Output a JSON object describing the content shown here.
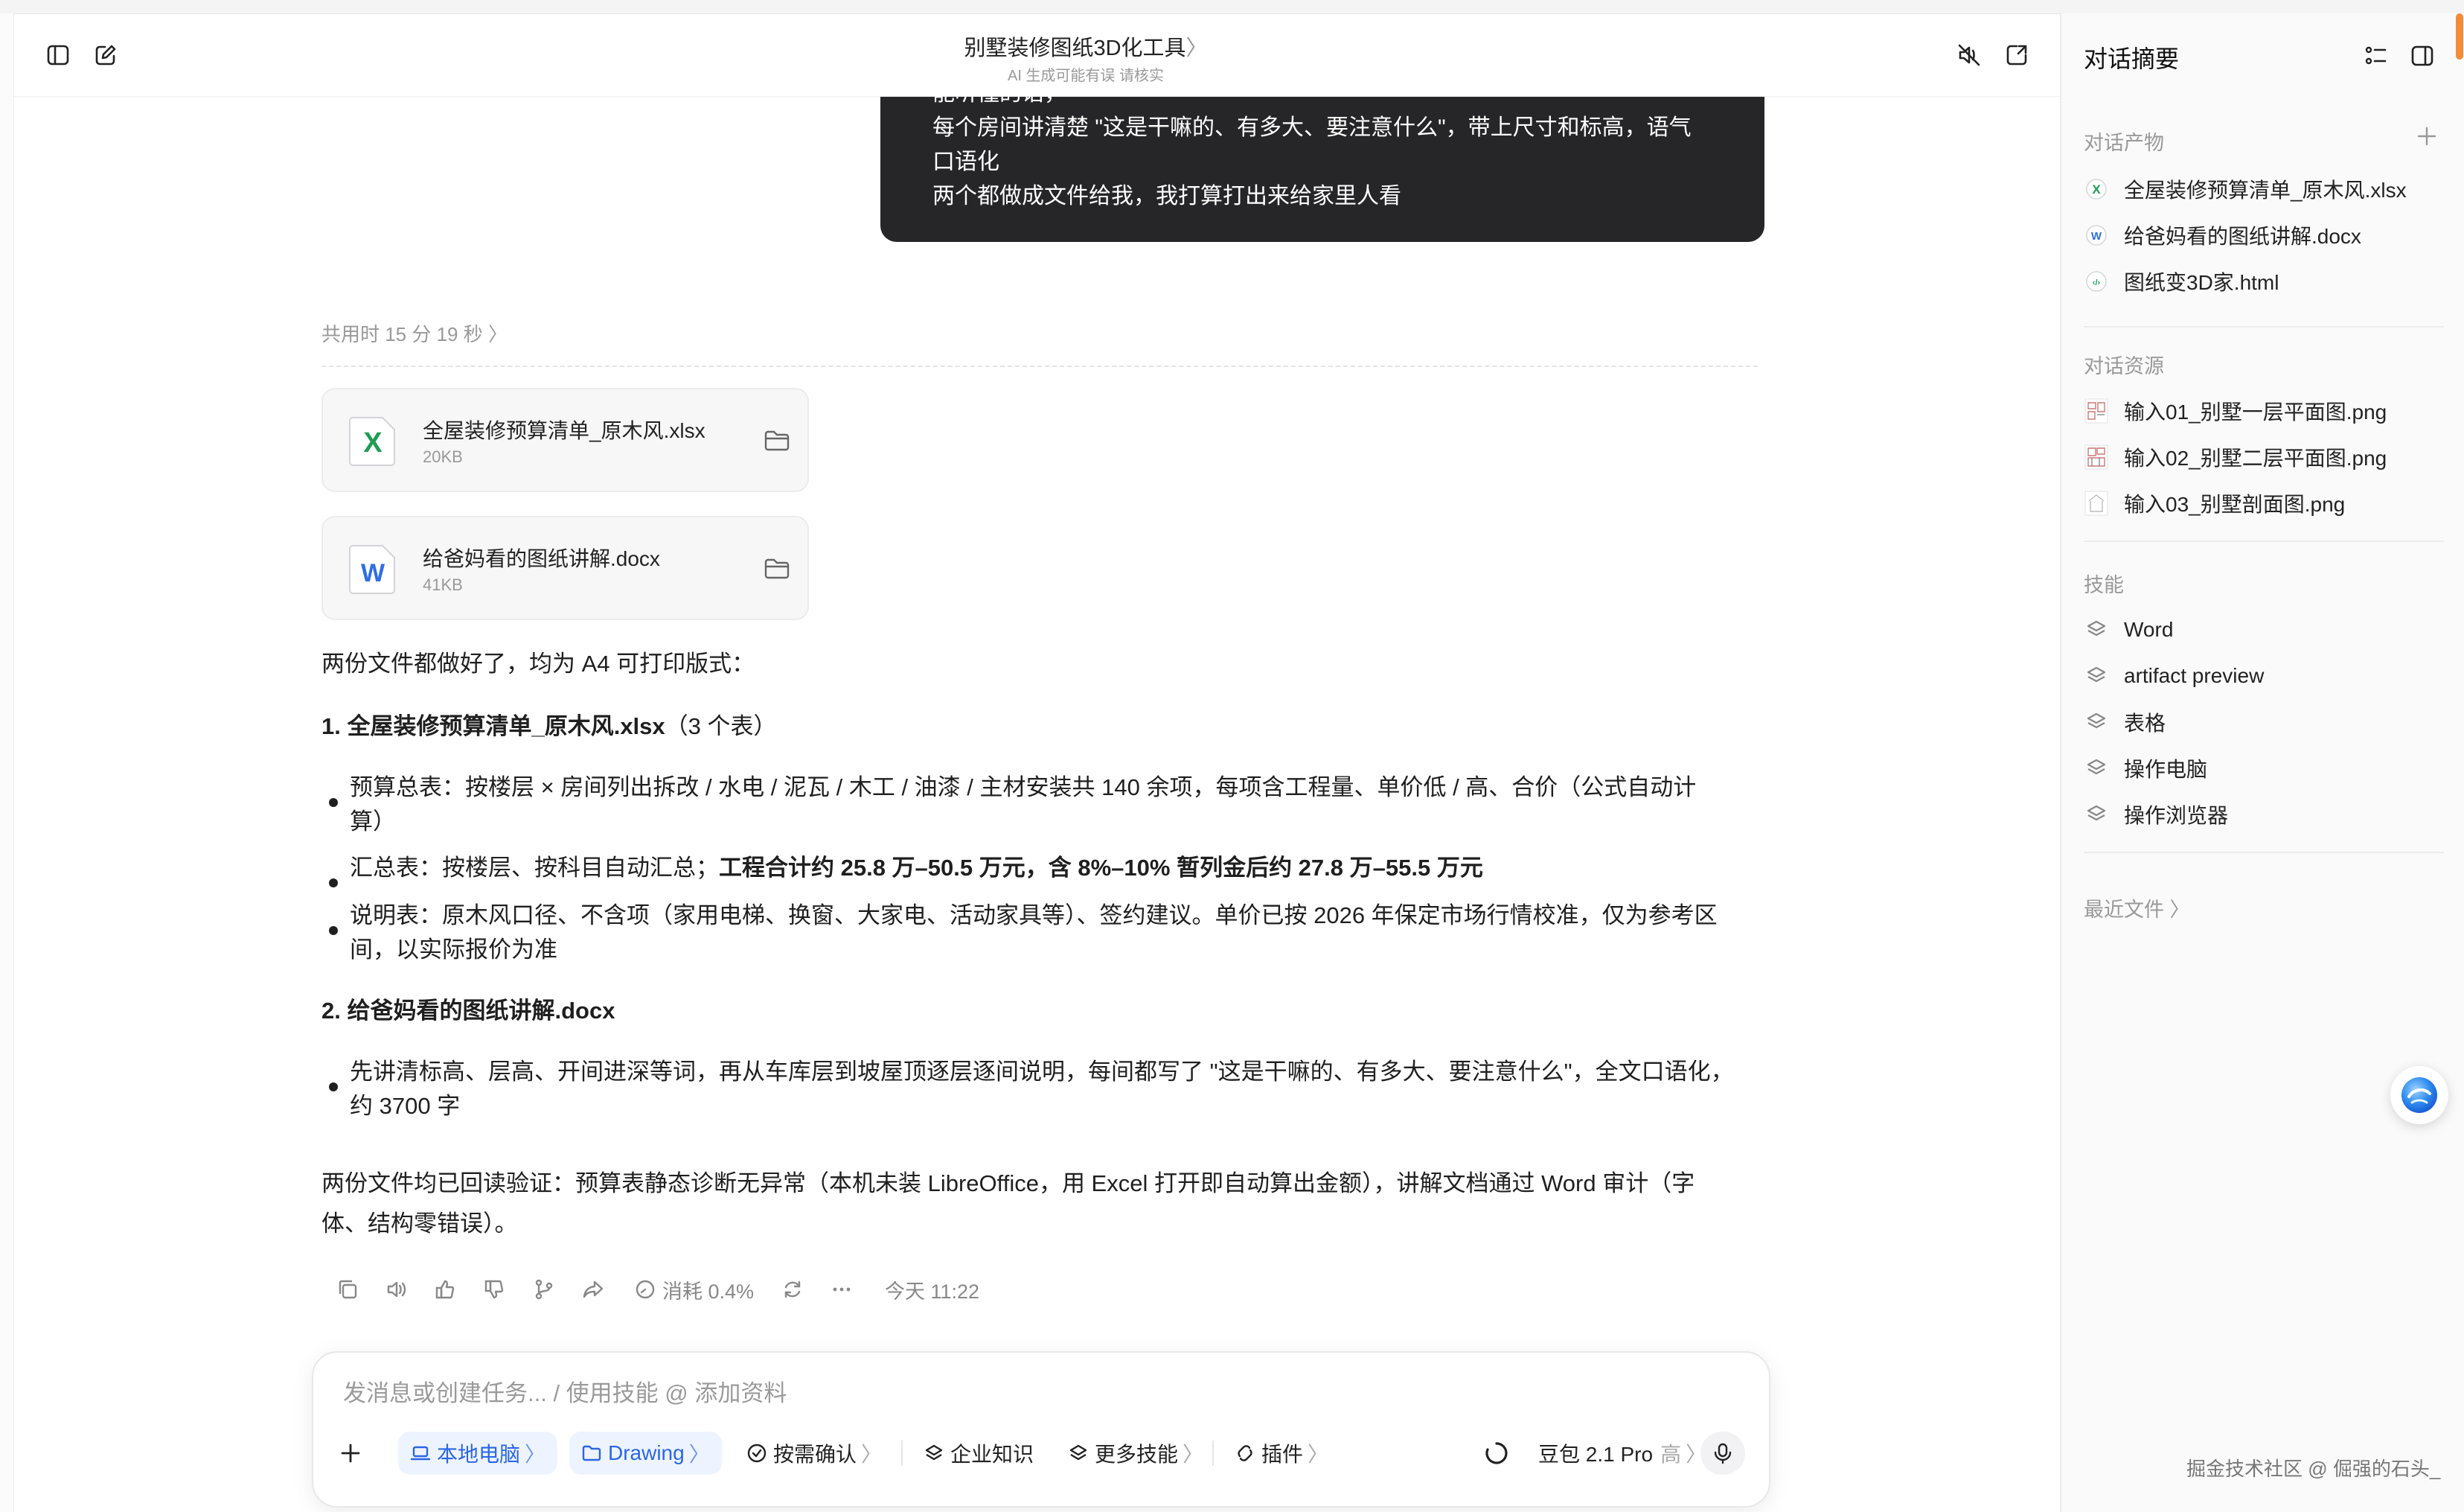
{
  "header": {
    "title": "别墅装修图纸3D化工具",
    "title_chevron": "〉",
    "subtitle": "AI 生成可能有误 请核实"
  },
  "user_message": {
    "line0": "能听懂的话，",
    "line1": "每个房间讲清楚 \"这是干嘛的、有多大、要注意什么\"，带上尺寸和标高，语气",
    "line2": "口语化",
    "line3": "两个都做成文件给我，我打算打出来给家里人看"
  },
  "elapsed": "共用时 15 分 19 秒 〉",
  "files": [
    {
      "name": "全屋装修预算清单_原木风.xlsx",
      "size": "20KB",
      "type": "excel",
      "letter": "X"
    },
    {
      "name": "给爸妈看的图纸讲解.docx",
      "size": "41KB",
      "type": "word",
      "letter": "W"
    }
  ],
  "reply": {
    "intro": "两份文件都做好了，均为 A4 可打印版式：",
    "section1_title": "1. 全屋装修预算清单_原木风.xlsx",
    "section1_suffix": "（3 个表）",
    "b1_line1": "预算总表：按楼层 × 房间列出拆改 / 水电 / 泥瓦 / 木工 / 油漆 / 主材安装共 140 余项，每项含工程量、单价低 / 高、合价（公式自动计",
    "b1_line2": "算）",
    "b2_prefix": "汇总表：按楼层、按科目自动汇总；",
    "b2_bold": "工程合计约 25.8 万–50.5 万元，含 8%–10% 暂列金后约 27.8 万–55.5 万元",
    "b3_line1": "说明表：原木风口径、不含项（家用电梯、换窗、大家电、活动家具等）、签约建议。单价已按 2026 年保定市场行情校准，仅为参考区",
    "b3_line2": "间，以实际报价为准",
    "section2_title": "2. 给爸妈看的图纸讲解.docx",
    "b4_line1": "先讲清标高、层高、开间进深等词，再从车库层到坡屋顶逐层逐间说明，每间都写了 \"这是干嘛的、有多大、要注意什么\"，全文口语化，",
    "b4_line2": "约 3700 字",
    "verify_line1": "两份文件均已回读验证：预算表静态诊断无异常（本机未装 LibreOffice，用 Excel 打开即自动算出金额），讲解文档通过 Word 审计（字",
    "verify_line2": "体、结构零错误）。"
  },
  "actions": {
    "consumption": "消耗 0.4%",
    "time": "今天 11:22"
  },
  "composer": {
    "placeholder": "发消息或创建任务... / 使用技能 @ 添加资料",
    "chip_local": "本地电脑",
    "chip_drawing": "Drawing",
    "chip_confirm": "按需确认",
    "chip_knowledge": "企业知识",
    "chip_skills": "更多技能",
    "chip_plugins": "插件",
    "model_name": "豆包 2.1 Pro",
    "model_level": "高",
    "chevron": "〉"
  },
  "sidebar": {
    "title": "对话摘要",
    "artifacts_heading": "对话产物",
    "artifacts": [
      {
        "name": "全屋装修预算清单_原木风.xlsx",
        "type": "excel",
        "letter": "X"
      },
      {
        "name": "给爸妈看的图纸讲解.docx",
        "type": "word",
        "letter": "W"
      },
      {
        "name": "图纸变3D家.html",
        "type": "html",
        "letter": "‹/›"
      }
    ],
    "resources_heading": "对话资源",
    "resources": [
      {
        "name": "输入01_别墅一层平面图.png"
      },
      {
        "name": "输入02_别墅二层平面图.png"
      },
      {
        "name": "输入03_别墅剖面图.png"
      }
    ],
    "skills_heading": "技能",
    "skills": [
      "Word",
      "artifact preview",
      "表格",
      "操作电脑",
      "操作浏览器"
    ],
    "recent": "最近文件 〉"
  },
  "watermark": "掘金技术社区 @ 倔强的石头_",
  "colors": {
    "accent_blue": "#2a66e6",
    "excel_green": "#1f9d55",
    "word_blue": "#2f6ee6",
    "bubble_bg": "#262628",
    "orange": "#f08c3a"
  }
}
